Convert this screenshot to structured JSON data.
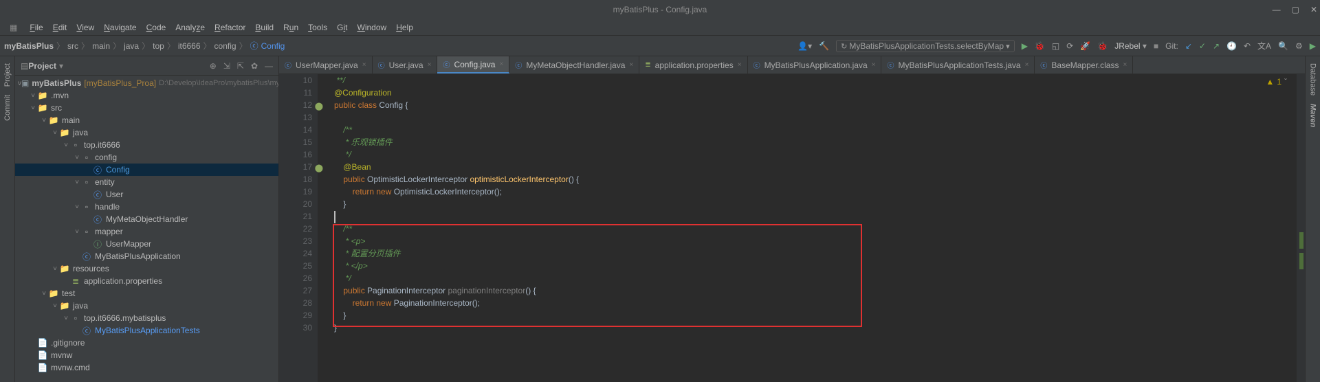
{
  "window": {
    "title": "myBatisPlus - Config.java"
  },
  "menu": [
    "File",
    "Edit",
    "View",
    "Navigate",
    "Code",
    "Analyze",
    "Refactor",
    "Build",
    "Run",
    "Tools",
    "Git",
    "Window",
    "Help"
  ],
  "breadcrumb": [
    "myBatisPlus",
    "src",
    "main",
    "java",
    "top",
    "it6666",
    "config",
    "Config"
  ],
  "toolbar": {
    "runconfig": "MyBatisPlusApplicationTests.selectByMap",
    "jrebel": "JRebel",
    "gitlabel": "Git:"
  },
  "project": {
    "title": "Project",
    "path": "D:\\Develop\\IdeaPro\\mybatisPlus\\myBat...",
    "root": "myBatisPlus",
    "rootTag": "[myBatisPlus_Proa]",
    "nodes": [
      {
        "ind": 1,
        "arrow": "v",
        "icon": "folder",
        "lbl": ".mvn"
      },
      {
        "ind": 1,
        "arrow": "v",
        "icon": "folder",
        "lbl": "src"
      },
      {
        "ind": 2,
        "arrow": "v",
        "icon": "folder",
        "lbl": "main"
      },
      {
        "ind": 3,
        "arrow": "v",
        "icon": "folder",
        "lbl": "java",
        "src": true
      },
      {
        "ind": 4,
        "arrow": "v",
        "icon": "pkg",
        "lbl": "top.it6666"
      },
      {
        "ind": 5,
        "arrow": "v",
        "icon": "pkg",
        "lbl": "config"
      },
      {
        "ind": 6,
        "arrow": "",
        "icon": "cls",
        "lbl": "Config",
        "sel": true
      },
      {
        "ind": 5,
        "arrow": "v",
        "icon": "pkg",
        "lbl": "entity"
      },
      {
        "ind": 6,
        "arrow": "",
        "icon": "cls",
        "lbl": "User"
      },
      {
        "ind": 5,
        "arrow": "v",
        "icon": "pkg",
        "lbl": "handle"
      },
      {
        "ind": 6,
        "arrow": "",
        "icon": "cls",
        "lbl": "MyMetaObjectHandler"
      },
      {
        "ind": 5,
        "arrow": "v",
        "icon": "pkg",
        "lbl": "mapper"
      },
      {
        "ind": 6,
        "arrow": "",
        "icon": "int",
        "lbl": "UserMapper"
      },
      {
        "ind": 5,
        "arrow": "",
        "icon": "cls",
        "lbl": "MyBatisPlusApplication"
      },
      {
        "ind": 3,
        "arrow": "v",
        "icon": "folder",
        "lbl": "resources",
        "res": true
      },
      {
        "ind": 4,
        "arrow": "",
        "icon": "prop",
        "lbl": "application.properties"
      },
      {
        "ind": 2,
        "arrow": "v",
        "icon": "folder",
        "lbl": "test"
      },
      {
        "ind": 3,
        "arrow": "v",
        "icon": "folder",
        "lbl": "java",
        "src": true
      },
      {
        "ind": 4,
        "arrow": "v",
        "icon": "pkg",
        "lbl": "top.it6666.mybatisplus"
      },
      {
        "ind": 5,
        "arrow": "",
        "icon": "cls",
        "lbl": "MyBatisPlusApplicationTests",
        "hl": true
      },
      {
        "ind": 1,
        "arrow": "",
        "icon": "file",
        "lbl": ".gitignore"
      },
      {
        "ind": 1,
        "arrow": "",
        "icon": "file",
        "lbl": "mvnw"
      },
      {
        "ind": 1,
        "arrow": "",
        "icon": "file",
        "lbl": "mvnw.cmd"
      }
    ]
  },
  "tabs": [
    {
      "icon": "c",
      "label": "UserMapper.java"
    },
    {
      "icon": "c",
      "label": "User.java"
    },
    {
      "icon": "c",
      "label": "Config.java",
      "active": true
    },
    {
      "icon": "c",
      "label": "MyMetaObjectHandler.java"
    },
    {
      "icon": "g",
      "label": "application.properties"
    },
    {
      "icon": "c",
      "label": "MyBatisPlusApplication.java"
    },
    {
      "icon": "c",
      "label": "MyBatisPlusApplicationTests.java"
    },
    {
      "icon": "c",
      "label": "BaseMapper.class"
    }
  ],
  "code": {
    "startLine": 10,
    "lines": [
      {
        "n": 10,
        "html": "<span class='comment'> **/</span>"
      },
      {
        "n": 11,
        "html": "<span class='ann'>@Configuration</span>"
      },
      {
        "n": 12,
        "html": "<span class='kw'>public class</span> <span class='cls'>Config</span> {",
        "marker": true
      },
      {
        "n": 13,
        "html": ""
      },
      {
        "n": 14,
        "html": "    <span class='comment'>/**</span>"
      },
      {
        "n": 15,
        "html": "    <span class='commentit'> * 乐观锁插件</span>"
      },
      {
        "n": 16,
        "html": "    <span class='comment'> */</span>"
      },
      {
        "n": 17,
        "html": "    <span class='ann'>@Bean</span>",
        "marker": true
      },
      {
        "n": 18,
        "html": "    <span class='kw'>public</span> <span class='cls'>OptimisticLockerInterceptor</span> <span class='method'>optimisticLockerInterceptor</span>() {"
      },
      {
        "n": 19,
        "html": "        <span class='kw'>return new</span> <span class='cls'>OptimisticLockerInterceptor</span>();"
      },
      {
        "n": 20,
        "html": "    }"
      },
      {
        "n": 21,
        "html": "<span class='cursor'></span>"
      },
      {
        "n": 22,
        "html": "    <span class='comment'>/**</span>"
      },
      {
        "n": 23,
        "html": "    <span class='comment'> * &lt;p&gt;</span>"
      },
      {
        "n": 24,
        "html": "    <span class='commentit'> * 配置分页插件</span>"
      },
      {
        "n": 25,
        "html": "    <span class='comment'> * &lt;/p&gt;</span>"
      },
      {
        "n": 26,
        "html": "    <span class='comment'> */</span>"
      },
      {
        "n": 27,
        "html": "    <span class='kw'>public</span> <span class='cls'>PaginationInterceptor</span> <span class='param'>paginationInterceptor</span>() {"
      },
      {
        "n": 28,
        "html": "        <span class='kw'>return new</span> <span class='cls'>PaginationInterceptor</span>();"
      },
      {
        "n": 29,
        "html": "    }"
      },
      {
        "n": 30,
        "html": "}"
      }
    ]
  },
  "warnings": {
    "count": "1"
  },
  "sidetools": {
    "left": [
      "Commit",
      "Project"
    ],
    "right": [
      "Database",
      "Maven"
    ]
  }
}
